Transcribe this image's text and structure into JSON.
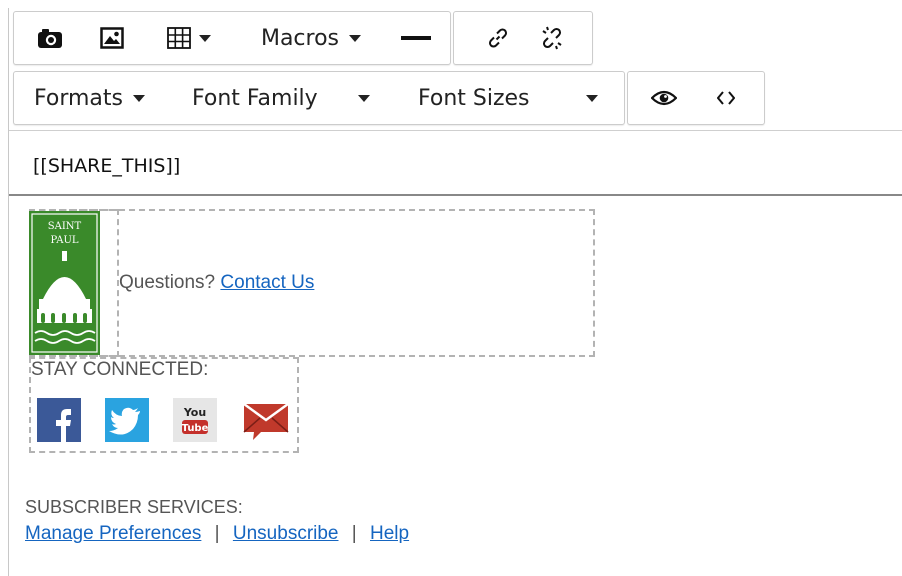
{
  "toolbar": {
    "row1": {
      "camera_icon": "camera-icon",
      "image_icon": "image-icon",
      "table_icon": "table-icon",
      "macros_label": "Macros",
      "hr_icon": "horizontal-rule-icon",
      "link_icon": "link-icon",
      "unlink_icon": "unlink-icon"
    },
    "row2": {
      "formats_label": "Formats",
      "font_family_label": "Font Family",
      "font_sizes_label": "Font Sizes",
      "preview_icon": "eye-icon",
      "source_icon": "code-icon"
    }
  },
  "content": {
    "share_token": "[[SHARE_THIS]]",
    "logo": {
      "line1": "SAINT",
      "line2": "PAUL",
      "color": "#3a8a2a"
    },
    "questions_text": "Questions?",
    "contact_link": "Contact Us",
    "stay_connected": "STAY CONNECTED:",
    "social": [
      {
        "name": "facebook",
        "color": "#3b5998"
      },
      {
        "name": "twitter",
        "color": "#2aa3e0"
      },
      {
        "name": "youtube",
        "color": "#d8d8d8",
        "line1": "You",
        "line2": "Tube"
      },
      {
        "name": "email",
        "color": "#c0392b"
      }
    ],
    "subscriber_services": "SUBSCRIBER SERVICES:",
    "links": {
      "manage": "Manage Preferences",
      "unsubscribe": "Unsubscribe",
      "help": "Help",
      "sep": "|"
    },
    "link_color": "#1565c0"
  }
}
